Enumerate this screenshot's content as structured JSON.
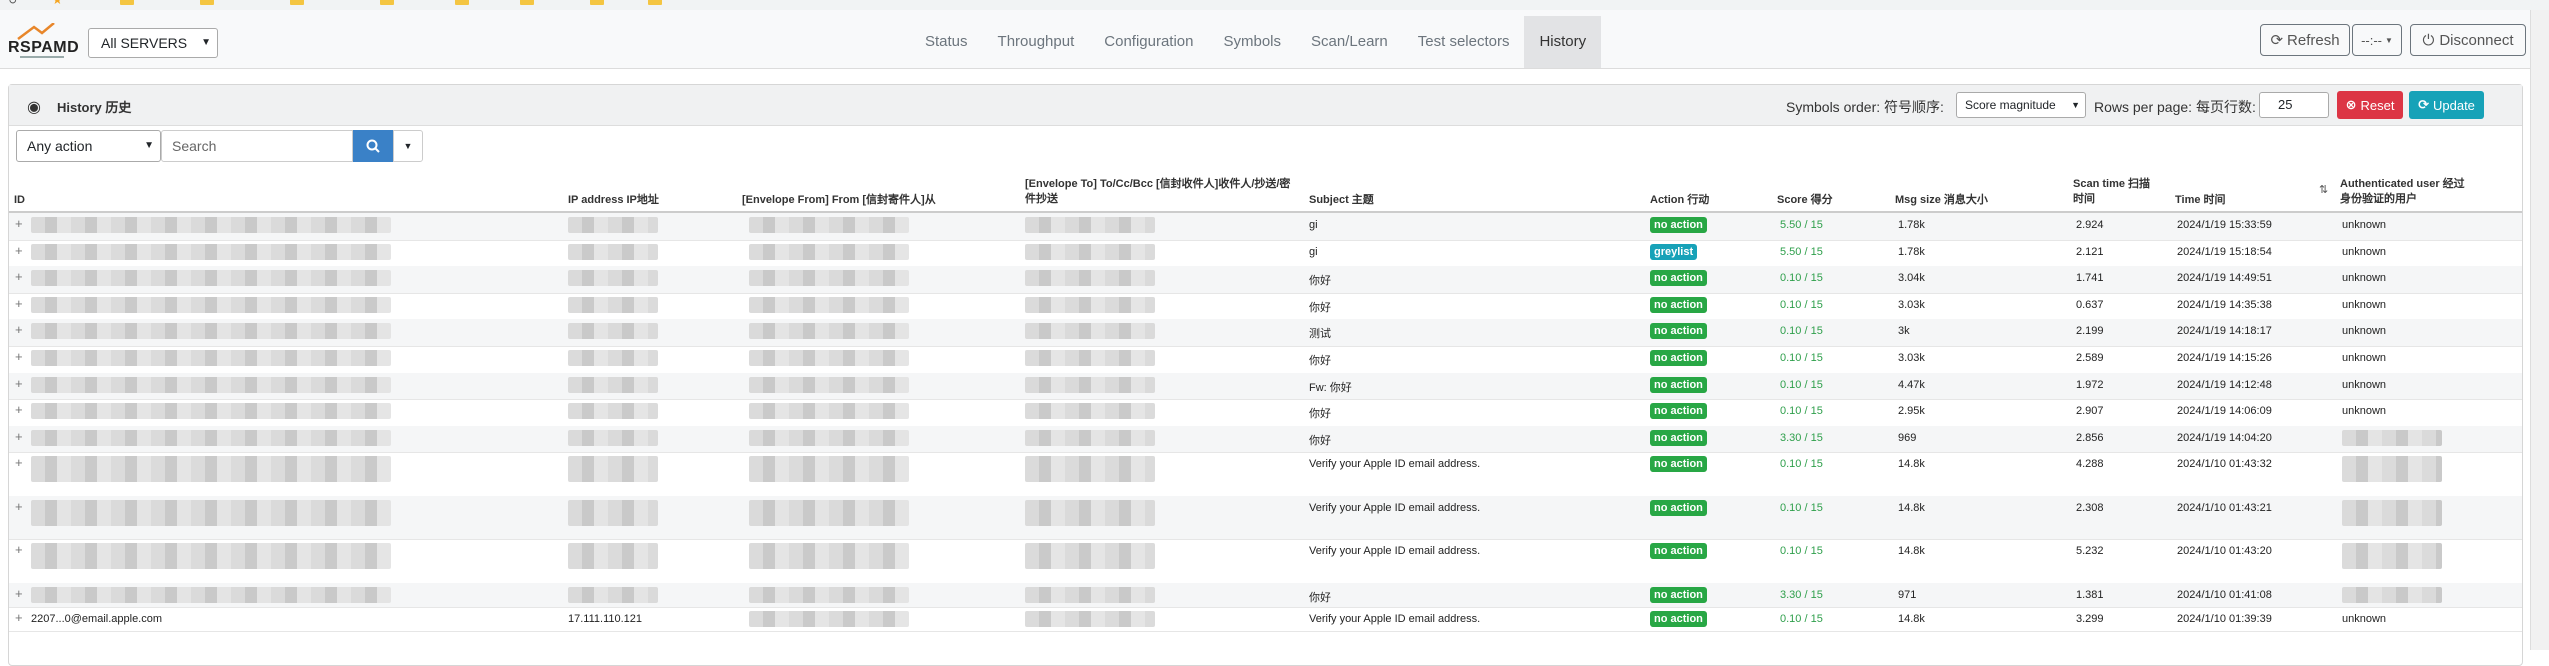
{
  "bookmarks": [
    "",
    "",
    "",
    "",
    "",
    "",
    "",
    "",
    ""
  ],
  "navbar": {
    "logo": "RSPAMD",
    "server_select": "All SERVERS",
    "tabs": [
      {
        "label": "Status",
        "active": false
      },
      {
        "label": "Throughput",
        "active": false
      },
      {
        "label": "Configuration",
        "active": false
      },
      {
        "label": "Symbols",
        "active": false
      },
      {
        "label": "Scan/Learn",
        "active": false
      },
      {
        "label": "Test selectors",
        "active": false
      },
      {
        "label": "History",
        "active": true
      }
    ],
    "refresh_label": "Refresh",
    "interval_label": "--:--",
    "disconnect_label": "Disconnect"
  },
  "history": {
    "title": "History 历史",
    "symbols_order_label": "Symbols order: 符号顺序:",
    "symbols_order_value": "Score magnitude",
    "rows_per_page_label": "Rows per page: 每页行数:",
    "rows_per_page_value": "25",
    "reset_label": "Reset",
    "update_label": "Update",
    "action_filter": "Any action",
    "search_placeholder": "Search",
    "columns": {
      "id": "ID",
      "ip": "IP address IP地址",
      "from": "[Envelope From] From [信封寄件人]从",
      "to": "[Envelope To] To/Cc/Bcc [信封收件人]收件人/抄送/密件抄送",
      "subject": "Subject 主题",
      "action": "Action 行动",
      "score": "Score 得分",
      "size": "Msg size 消息大小",
      "scan_time": "Scan time 扫描时间",
      "time": "Time 时间",
      "user": "Authenticated user 经过身份验证的用户"
    },
    "rows": [
      {
        "id": "",
        "ip": "",
        "subject": "gi",
        "action": "no action",
        "badge": "green",
        "score": "5.50 / 15",
        "size": "1.78k",
        "scan_time": "2.924",
        "time": "2024/1/19 15:33:59",
        "user": "unknown"
      },
      {
        "id": "",
        "ip": "",
        "subject": "gi",
        "action": "greylist",
        "badge": "teal",
        "score": "5.50 / 15",
        "size": "1.78k",
        "scan_time": "2.121",
        "time": "2024/1/19 15:18:54",
        "user": "unknown"
      },
      {
        "id": "",
        "ip": "",
        "subject": "你好",
        "action": "no action",
        "badge": "green",
        "score": "0.10 / 15",
        "size": "3.04k",
        "scan_time": "1.741",
        "time": "2024/1/19 14:49:51",
        "user": "unknown"
      },
      {
        "id": "",
        "ip": "",
        "subject": "你好",
        "action": "no action",
        "badge": "green",
        "score": "0.10 / 15",
        "size": "3.03k",
        "scan_time": "0.637",
        "time": "2024/1/19 14:35:38",
        "user": "unknown"
      },
      {
        "id": "",
        "ip": "",
        "subject": "测试",
        "action": "no action",
        "badge": "green",
        "score": "0.10 / 15",
        "size": "3k",
        "scan_time": "2.199",
        "time": "2024/1/19 14:18:17",
        "user": "unknown"
      },
      {
        "id": "",
        "ip": "",
        "subject": "你好",
        "action": "no action",
        "badge": "green",
        "score": "0.10 / 15",
        "size": "3.03k",
        "scan_time": "2.589",
        "time": "2024/1/19 14:15:26",
        "user": "unknown"
      },
      {
        "id": "",
        "ip": "",
        "subject": "Fw: 你好",
        "action": "no action",
        "badge": "green",
        "score": "0.10 / 15",
        "size": "4.47k",
        "scan_time": "1.972",
        "time": "2024/1/19 14:12:48",
        "user": "unknown"
      },
      {
        "id": "",
        "ip": "",
        "subject": "你好",
        "action": "no action",
        "badge": "green",
        "score": "0.10 / 15",
        "size": "2.95k",
        "scan_time": "2.907",
        "time": "2024/1/19 14:06:09",
        "user": "unknown"
      },
      {
        "id": "",
        "ip": "",
        "subject": "你好",
        "action": "no action",
        "badge": "green",
        "score": "3.30 / 15",
        "size": "969",
        "scan_time": "2.856",
        "time": "2024/1/19 14:04:20",
        "user": ""
      },
      {
        "id": "",
        "ip": "",
        "subject": "Verify your Apple ID email address.",
        "action": "no action",
        "badge": "green",
        "score": "0.10 / 15",
        "size": "14.8k",
        "scan_time": "4.288",
        "time": "2024/1/10 01:43:32",
        "user": ""
      },
      {
        "id": "",
        "ip": "",
        "subject": "Verify your Apple ID email address.",
        "action": "no action",
        "badge": "green",
        "score": "0.10 / 15",
        "size": "14.8k",
        "scan_time": "2.308",
        "time": "2024/1/10 01:43:21",
        "user": ""
      },
      {
        "id": "",
        "ip": "",
        "subject": "Verify your Apple ID email address.",
        "action": "no action",
        "badge": "green",
        "score": "0.10 / 15",
        "size": "14.8k",
        "scan_time": "5.232",
        "time": "2024/1/10 01:43:20",
        "user": ""
      },
      {
        "id": "",
        "ip": "",
        "subject": "你好",
        "action": "no action",
        "badge": "green",
        "score": "3.30 / 15",
        "size": "971",
        "scan_time": "1.381",
        "time": "2024/1/10 01:41:08",
        "user": ""
      },
      {
        "id": "2207...0@email.apple.com",
        "ip": "17.111.110.121",
        "subject": "Verify your Apple ID email address.",
        "action": "no action",
        "badge": "green",
        "score": "0.10 / 15",
        "size": "14.8k",
        "scan_time": "3.299",
        "time": "2024/1/10 01:39:39",
        "user": "unknown"
      }
    ]
  }
}
